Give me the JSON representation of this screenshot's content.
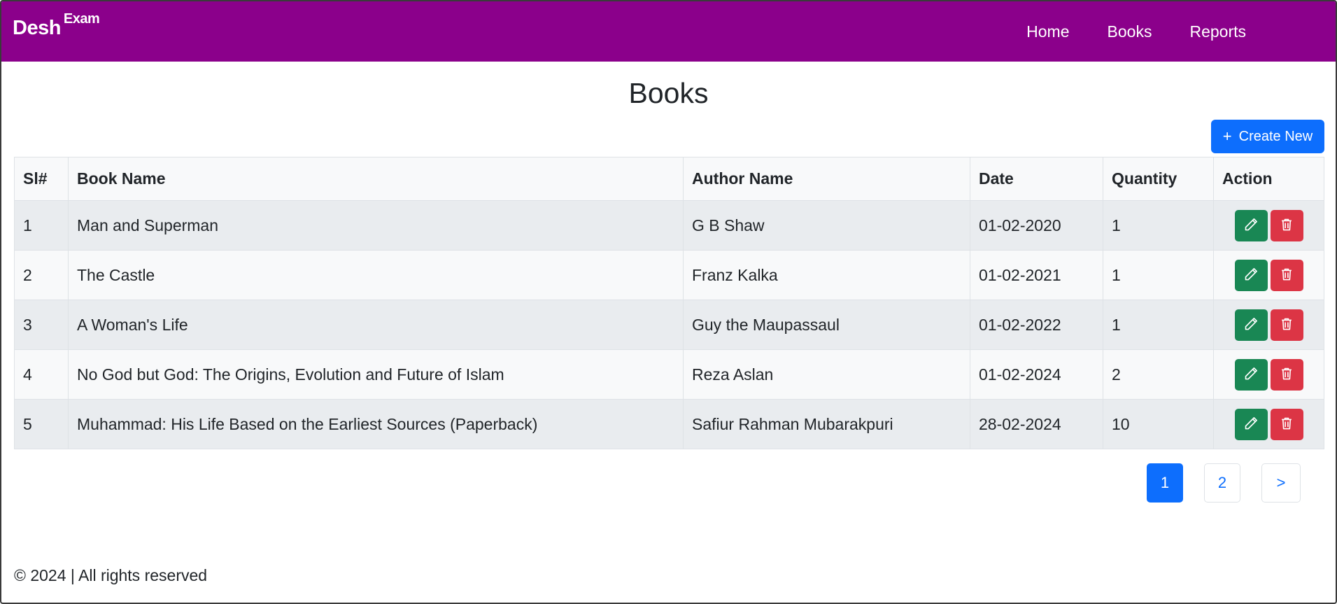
{
  "navbar": {
    "brand_main": "Desh",
    "brand_sup": "Exam",
    "links": [
      "Home",
      "Books",
      "Reports"
    ],
    "bg_color": "#8b008b"
  },
  "page": {
    "title": "Books",
    "create_button": "Create New",
    "create_icon": "plus-icon"
  },
  "table": {
    "headers": [
      "Sl#",
      "Book Name",
      "Author Name",
      "Date",
      "Quantity",
      "Action"
    ],
    "rows": [
      {
        "sl": "1",
        "book": "Man and Superman",
        "author": "G B Shaw",
        "date": "01-02-2020",
        "qty": "1"
      },
      {
        "sl": "2",
        "book": "The Castle",
        "author": "Franz Kalka",
        "date": "01-02-2021",
        "qty": "1"
      },
      {
        "sl": "3",
        "book": "A Woman's Life",
        "author": "Guy the Maupassaul",
        "date": "01-02-2022",
        "qty": "1"
      },
      {
        "sl": "4",
        "book": "No God but God: The Origins, Evolution and Future of Islam",
        "author": "Reza Aslan",
        "date": "01-02-2024",
        "qty": "2"
      },
      {
        "sl": "5",
        "book": "Muhammad: His Life Based on the Earliest Sources (Paperback)",
        "author": "Safiur Rahman Mubarakpuri",
        "date": "28-02-2024",
        "qty": "10"
      }
    ],
    "action_icons": [
      "pencil-icon",
      "trash-icon"
    ]
  },
  "pagination": {
    "pages": [
      "1",
      "2"
    ],
    "next": ">",
    "current": "1"
  },
  "footer": {
    "text": "© 2024 | All rights reserved"
  },
  "colors": {
    "primary": "#0d6efd",
    "success": "#198754",
    "danger": "#dc3545"
  }
}
